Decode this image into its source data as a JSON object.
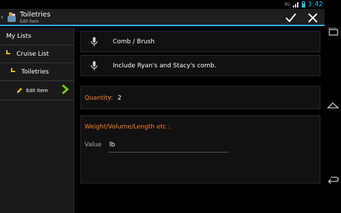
{
  "status_bar": {
    "network": "3G",
    "time": "3:42",
    "accent_color": "#33b5e5"
  },
  "action_bar": {
    "title": "Toiletries",
    "subtitle": "Edit Item",
    "app_icon": "toiletries-app-icon",
    "confirm_icon": "check-icon",
    "cancel_icon": "close-icon"
  },
  "sidebar": {
    "items": [
      {
        "label": "My Lists",
        "icon": ""
      },
      {
        "label": "Cruise List",
        "icon": "list-corner-icon"
      },
      {
        "label": "Toiletries",
        "icon": "list-corner-icon"
      },
      {
        "label": "Edit Item",
        "icon": "pencil-icon",
        "trailing_icon": "chevron-right-icon",
        "active": true
      }
    ]
  },
  "form": {
    "name_value": "Comb / Brush",
    "note_value": "Include Ryan's and Stacy's comb.",
    "quantity_label": "Quantity:",
    "quantity_value": "2",
    "measure_heading": "Weight/Volume/Length etc :",
    "value_label": "Value",
    "value_unit": "lb",
    "label_color": "#ff7f27"
  },
  "system_nav": {
    "recents_icon": "recents-icon",
    "home_icon": "home-icon",
    "back_icon": "back-icon"
  }
}
